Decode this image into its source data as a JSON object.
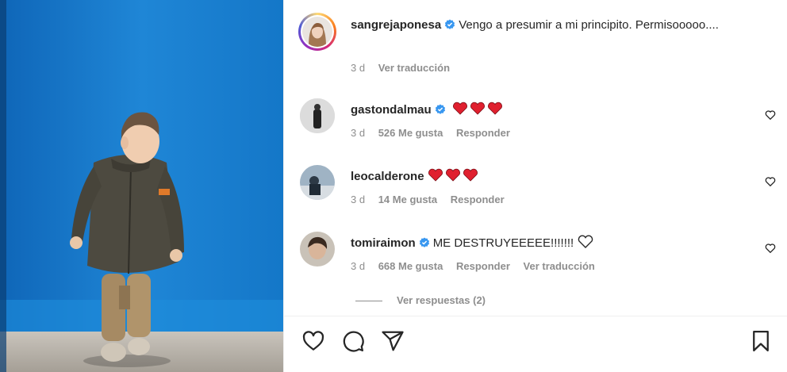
{
  "post": {
    "author": "sangrejaponesa",
    "caption": "Vengo a presumir a mi principito. Permisooooo....",
    "time": "3 d",
    "translate": "Ver traducción"
  },
  "comments": [
    {
      "user": "gastondalmau",
      "verified": true,
      "text": "",
      "hearts": 3,
      "time": "3 d",
      "likes": "526 Me gusta",
      "reply": "Responder",
      "translate": ""
    },
    {
      "user": "leocalderone",
      "verified": false,
      "text": "",
      "hearts": 3,
      "time": "3 d",
      "likes": "14 Me gusta",
      "reply": "Responder",
      "translate": ""
    },
    {
      "user": "tomiraimon",
      "verified": true,
      "text": "ME DESTRUYEEEEE!!!!!!!",
      "hearts": 0,
      "time": "3 d",
      "likes": "668 Me gusta",
      "reply": "Responder",
      "translate": "Ver traducción"
    }
  ],
  "view_replies": "Ver respuestas (2)",
  "icons": {
    "like": "heart-outline-icon",
    "comment": "comment-bubble-icon",
    "share": "paper-plane-icon",
    "save": "bookmark-icon",
    "verified": "verified-badge-icon"
  },
  "colors": {
    "verified": "#3897f0",
    "heart_red": "#ed4956",
    "muted": "#8e8e8e",
    "media_bg": "#1a7fd0"
  }
}
